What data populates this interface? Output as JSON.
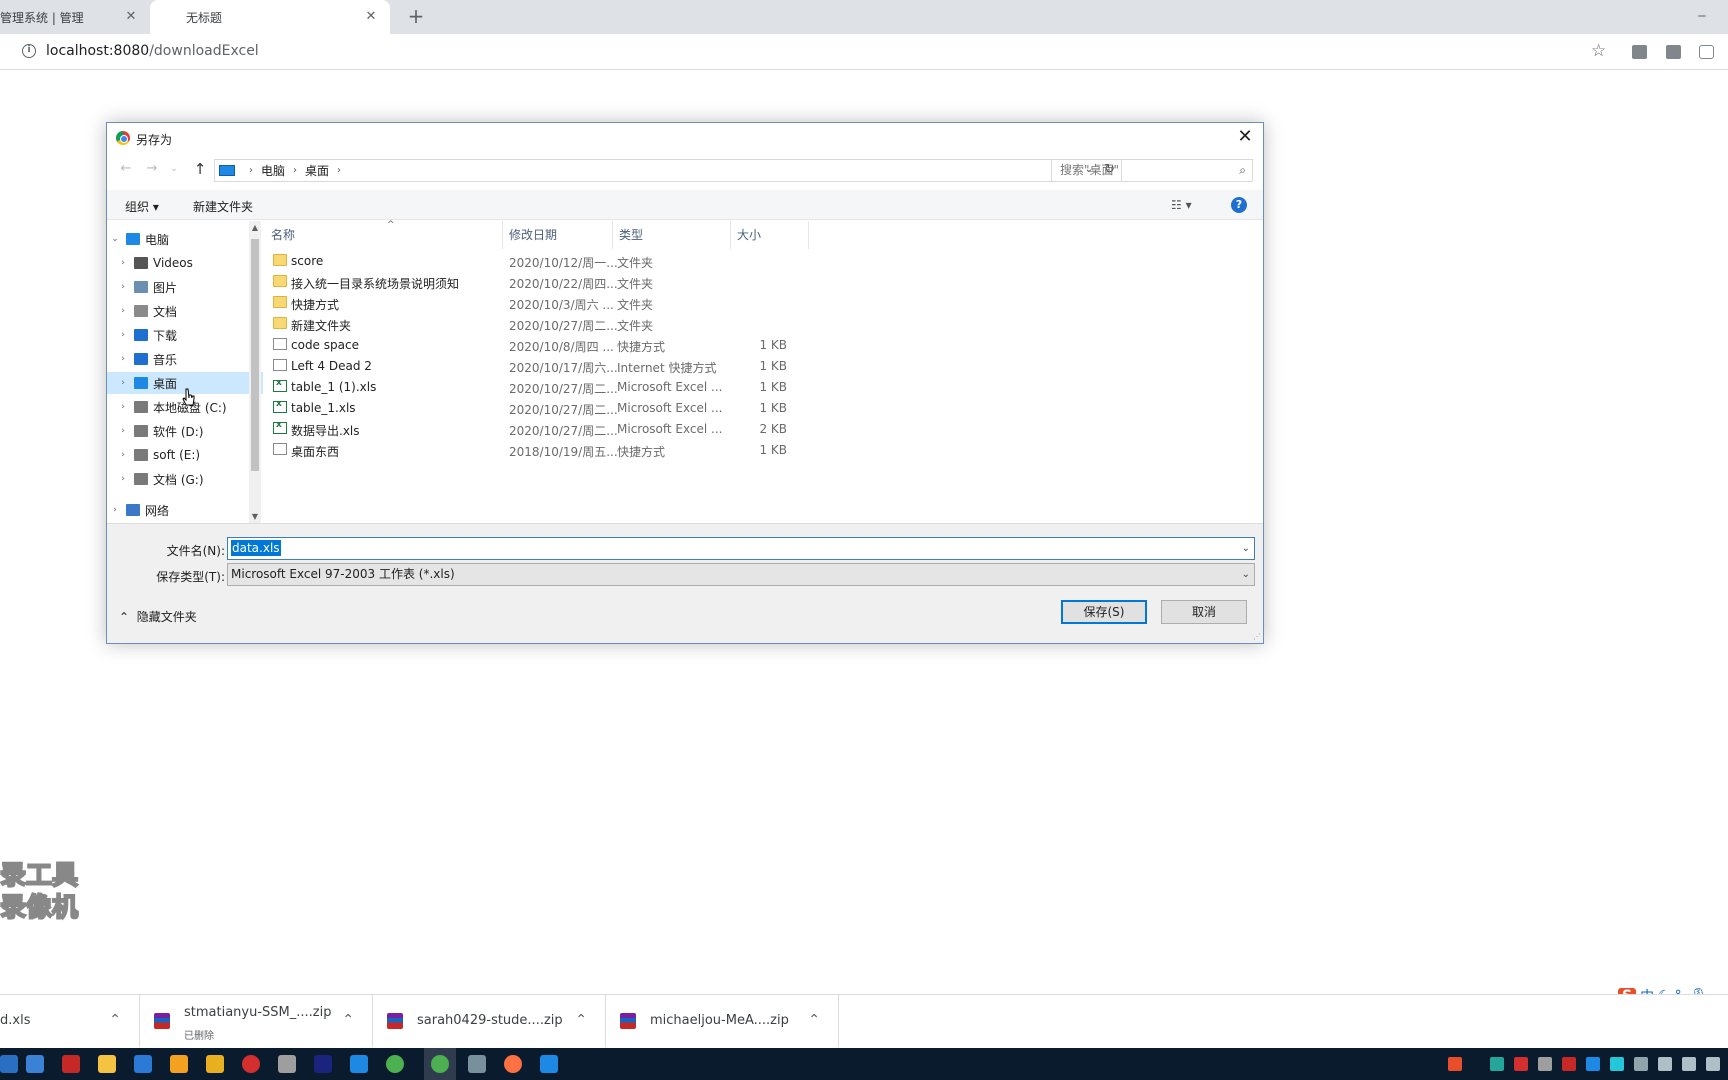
{
  "browser": {
    "tabs": [
      {
        "title": "管理系统 | 管理",
        "close": "✕"
      },
      {
        "title": "无标题",
        "close": "✕"
      }
    ],
    "new_tab": "+",
    "url_host": "localhost:8080",
    "url_path": "/downloadExcel",
    "bookmark_icon": "star-icon"
  },
  "dialog": {
    "title": "另存为",
    "close": "✕",
    "breadcrumb": [
      "电脑",
      "桌面"
    ],
    "search_placeholder": "搜索\"桌面\"",
    "toolbar": {
      "organize": "组织 ▾",
      "new_folder": "新建文件夹",
      "view": "☷ ▾",
      "help": "?"
    },
    "nav": [
      {
        "label": "电脑",
        "icon": "pc-icon",
        "color": "#1e88e5",
        "expanded": true
      },
      {
        "label": "Videos",
        "icon": "video-icon",
        "color": "#555555"
      },
      {
        "label": "图片",
        "icon": "pictures-icon",
        "color": "#6b8fb3"
      },
      {
        "label": "文档",
        "icon": "documents-icon",
        "color": "#8a8a8a"
      },
      {
        "label": "下载",
        "icon": "download-icon",
        "color": "#1e6fd0"
      },
      {
        "label": "音乐",
        "icon": "music-icon",
        "color": "#1e6fd0"
      },
      {
        "label": "桌面",
        "icon": "desktop-icon",
        "color": "#1e88e5",
        "selected": true
      },
      {
        "label": "本地磁盘 (C:)",
        "icon": "drive-c-icon",
        "color": "#7a7a7a"
      },
      {
        "label": "软件 (D:)",
        "icon": "drive-icon",
        "color": "#7a7a7a"
      },
      {
        "label": "soft (E:)",
        "icon": "drive-icon",
        "color": "#7a7a7a"
      },
      {
        "label": "文档 (G:)",
        "icon": "drive-icon",
        "color": "#7a7a7a"
      },
      {
        "label": "网络",
        "icon": "network-icon",
        "color": "#3c78c8"
      }
    ],
    "columns": [
      "名称",
      "修改日期",
      "类型",
      "大小"
    ],
    "files": [
      {
        "name": "score",
        "date": "2020/10/12/周一...",
        "type": "文件夹",
        "size": "",
        "kind": "folder"
      },
      {
        "name": "接入统一目录系统场景说明须知",
        "date": "2020/10/22/周四...",
        "type": "文件夹",
        "size": "",
        "kind": "folder"
      },
      {
        "name": "快捷方式",
        "date": "2020/10/3/周六 ...",
        "type": "文件夹",
        "size": "",
        "kind": "folder"
      },
      {
        "name": "新建文件夹",
        "date": "2020/10/27/周二...",
        "type": "文件夹",
        "size": "",
        "kind": "folder"
      },
      {
        "name": "code space",
        "date": "2020/10/8/周四 ...",
        "type": "快捷方式",
        "size": "1 KB",
        "kind": "shortcut"
      },
      {
        "name": "Left 4 Dead 2",
        "date": "2020/10/17/周六...",
        "type": "Internet 快捷方式",
        "size": "1 KB",
        "kind": "shortcut"
      },
      {
        "name": "table_1 (1).xls",
        "date": "2020/10/27/周二...",
        "type": "Microsoft Excel ...",
        "size": "1 KB",
        "kind": "xls"
      },
      {
        "name": "table_1.xls",
        "date": "2020/10/27/周二...",
        "type": "Microsoft Excel ...",
        "size": "1 KB",
        "kind": "xls"
      },
      {
        "name": "数据导出.xls",
        "date": "2020/10/27/周二...",
        "type": "Microsoft Excel ...",
        "size": "2 KB",
        "kind": "xls"
      },
      {
        "name": "桌面东西",
        "date": "2018/10/19/周五...",
        "type": "快捷方式",
        "size": "1 KB",
        "kind": "shortcut"
      }
    ],
    "filename_label": "文件名(N):",
    "filename_value": "data.xls",
    "filetype_label": "保存类型(T):",
    "filetype_value": "Microsoft Excel 97-2003 工作表 (*.xls)",
    "hide_folders": "隐藏文件夹",
    "save": "保存(S)",
    "cancel": "取消"
  },
  "watermark": [
    "录工具",
    "录像机"
  ],
  "downloads": [
    {
      "name": "d.xls",
      "status": ""
    },
    {
      "name": "stmatianyu-SSM_....zip",
      "status": "已删除"
    },
    {
      "name": "sarah0429-stude....zip",
      "status": ""
    },
    {
      "name": "michaeljou-MeA....zip",
      "status": ""
    }
  ],
  "ime": {
    "logo": "S",
    "mode": "中"
  },
  "colors": {
    "accent": "#0078d7",
    "selected_nav": "#cce8ff",
    "taskbar": "#0b1b2e"
  }
}
